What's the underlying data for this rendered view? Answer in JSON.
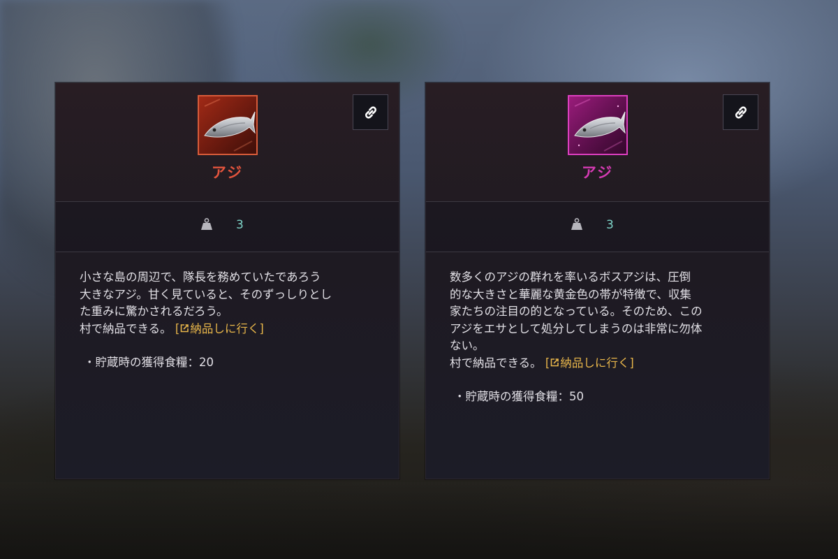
{
  "cards": [
    {
      "rarity_color": "#e3543d",
      "icon": "fish-icon",
      "name": "アジ",
      "weight": "3",
      "desc_lines": [
        "小さな島の周辺で、隊長を務めていたであろう",
        "大きなアジ。甘く見ていると、そのずっしりとし",
        "た重みに驚かされるだろう。"
      ],
      "deliver_text": "村で納品できる。",
      "deliver_link_open": "[",
      "deliver_link_label": "納品しに行く]",
      "stock_label": "・貯蔵時の獲得食糧：",
      "stock_value": "20"
    },
    {
      "rarity_color": "#d63bb4",
      "icon": "fish-icon",
      "name": "アジ",
      "weight": "3",
      "desc_lines": [
        "数多くのアジの群れを率いるボスアジは、圧倒",
        "的な大きさと華麗な黄金色の帯が特徴で、収集",
        "家たちの注目の的となっている。そのため、この",
        "アジをエサとして処分してしまうのは非常に勿体",
        "ない。"
      ],
      "deliver_text": "村で納品できる。",
      "deliver_link_open": "[",
      "deliver_link_label": "納品しに行く]",
      "stock_label": "・貯蔵時の獲得食糧：",
      "stock_value": "50"
    }
  ]
}
